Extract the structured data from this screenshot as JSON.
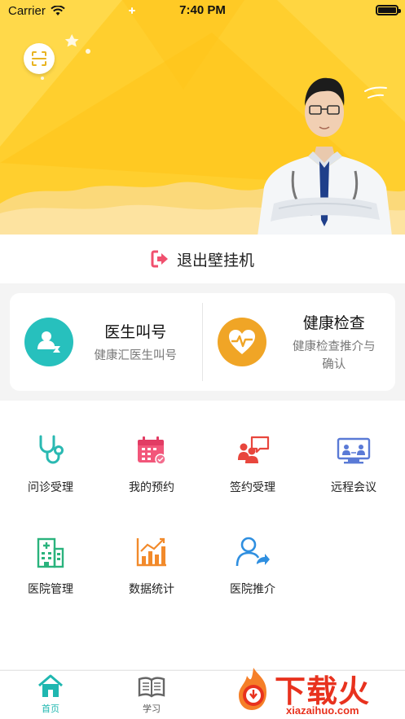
{
  "status_bar": {
    "carrier": "Carrier",
    "time": "7:40 PM",
    "wifi_icon": "wifi-icon",
    "battery_icon": "battery-icon"
  },
  "hero": {
    "scan_icon": "scan-icon",
    "banner_image": "doctor-portrait",
    "colors": {
      "background": "#ffcf2e",
      "wave": "#fbd97a"
    }
  },
  "logout": {
    "label": "退出壁挂机",
    "icon": "logout-icon",
    "icon_color": "#f0506e"
  },
  "cards": [
    {
      "title": "医生叫号",
      "subtitle": "健康汇医生叫号",
      "icon": "doctor-call-icon",
      "color": "#27c0bd"
    },
    {
      "title": "健康检查",
      "subtitle": "健康检查推介与确认",
      "icon": "heart-monitor-icon",
      "color": "#f0a526"
    }
  ],
  "grid": [
    {
      "label": "问诊受理",
      "icon": "stethoscope-icon",
      "color": "#2ab9b2"
    },
    {
      "label": "我的预约",
      "icon": "calendar-icon",
      "color": "#f2567a"
    },
    {
      "label": "签约受理",
      "icon": "team-chat-icon",
      "color": "#e8463d"
    },
    {
      "label": "远程会议",
      "icon": "video-conference-icon",
      "color": "#5a7ad6"
    },
    {
      "label": "医院管理",
      "icon": "hospital-icon",
      "color": "#2ab37d"
    },
    {
      "label": "数据统计",
      "icon": "bar-chart-icon",
      "color": "#f28a2b"
    },
    {
      "label": "医院推介",
      "icon": "user-share-icon",
      "color": "#2f8fe0"
    }
  ],
  "tabbar": {
    "tabs": [
      {
        "label": "首页",
        "icon": "home-icon",
        "active": true
      },
      {
        "label": "学习",
        "icon": "book-icon",
        "active": false
      }
    ],
    "active_color": "#1fb7b0"
  },
  "watermark": {
    "logo_text": "下载火",
    "url": "xiazaihuo.com"
  }
}
